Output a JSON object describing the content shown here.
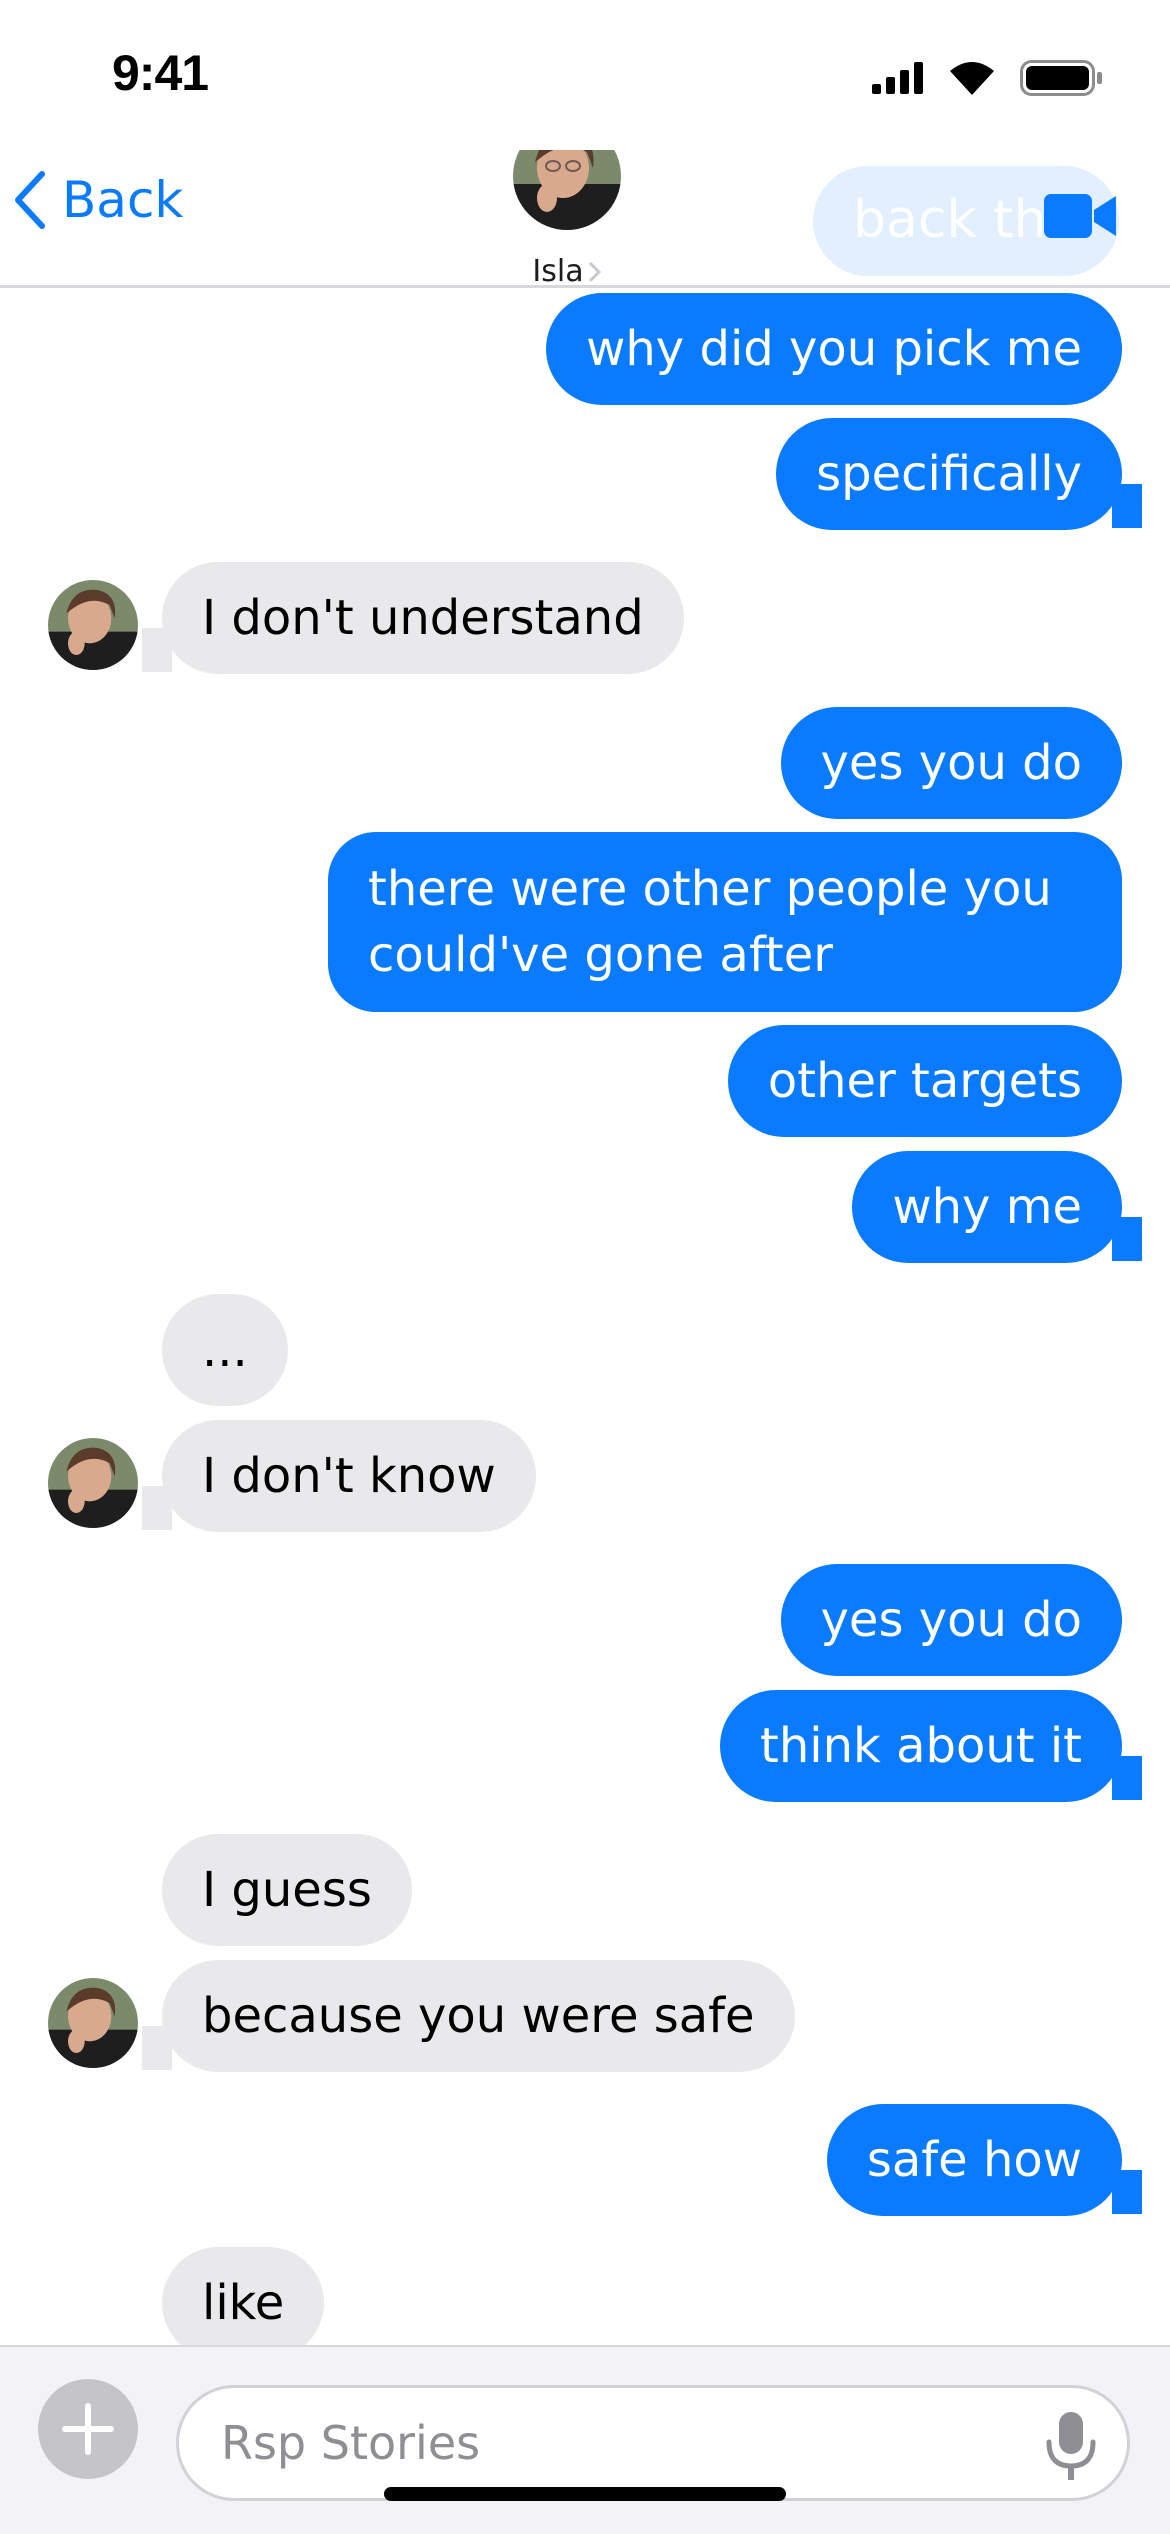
{
  "status_bar": {
    "time": "9:41"
  },
  "header": {
    "back_label": "Back",
    "contact_name": "Isla",
    "faded_preview_text": "back the"
  },
  "messages": [
    {
      "side": "sent",
      "text": "why did you pick me"
    },
    {
      "side": "sent",
      "text": "specifically"
    },
    {
      "side": "received",
      "text": "I don't understand"
    },
    {
      "side": "sent",
      "text": "yes you do"
    },
    {
      "side": "sent",
      "text": "there were other people you could've gone after"
    },
    {
      "side": "sent",
      "text": "other targets"
    },
    {
      "side": "sent",
      "text": "why me"
    },
    {
      "side": "received",
      "text": "..."
    },
    {
      "side": "received",
      "text": "I don't know"
    },
    {
      "side": "sent",
      "text": "yes you do"
    },
    {
      "side": "sent",
      "text": "think about it"
    },
    {
      "side": "received",
      "text": "I guess"
    },
    {
      "side": "received",
      "text": "because you were safe"
    },
    {
      "side": "sent",
      "text": "safe how"
    },
    {
      "side": "received",
      "text": "like"
    }
  ],
  "composer": {
    "placeholder": "Rsp Stories"
  },
  "icons": {
    "back": "chevron-left-icon",
    "disclosure": "chevron-right-icon",
    "video": "video-camera-icon",
    "add": "plus-icon",
    "mic": "microphone-icon",
    "signal": "cellular-signal-icon",
    "wifi": "wifi-icon",
    "battery": "battery-icon"
  },
  "colors": {
    "sent_bubble": "#0a7aff",
    "received_bubble": "#e9e9eb",
    "accent": "#0a7aff",
    "composer_background": "#f2f2f7"
  }
}
